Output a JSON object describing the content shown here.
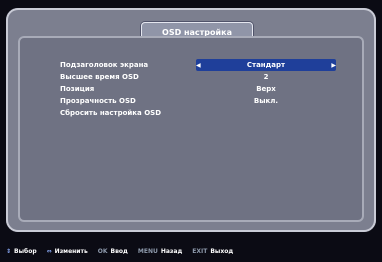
{
  "window": {
    "title": "OSD настройка"
  },
  "menu": {
    "items": [
      {
        "label": "Подзаголовок экрана",
        "value": "Стандарт"
      },
      {
        "label": "Высшее время OSD",
        "value": "2"
      },
      {
        "label": "Позиция",
        "value": "Верх"
      },
      {
        "label": "Прозрачность OSD",
        "value": "Выкл."
      },
      {
        "label": "Сбросить настройка OSD",
        "value": ""
      }
    ],
    "selected_index": 0
  },
  "footer": {
    "hints": [
      {
        "key": "⇕",
        "label": "Выбор"
      },
      {
        "key": "⇔",
        "label": "Изменить"
      },
      {
        "key": "OK",
        "label": "Ввод"
      },
      {
        "key": "MENU",
        "label": "Назад"
      },
      {
        "key": "EXIT",
        "label": "Выход"
      }
    ]
  },
  "colors": {
    "selected_bg": "#1f3f9a",
    "panel": "#7c7f8f",
    "panel_inner": "#6f7283"
  }
}
